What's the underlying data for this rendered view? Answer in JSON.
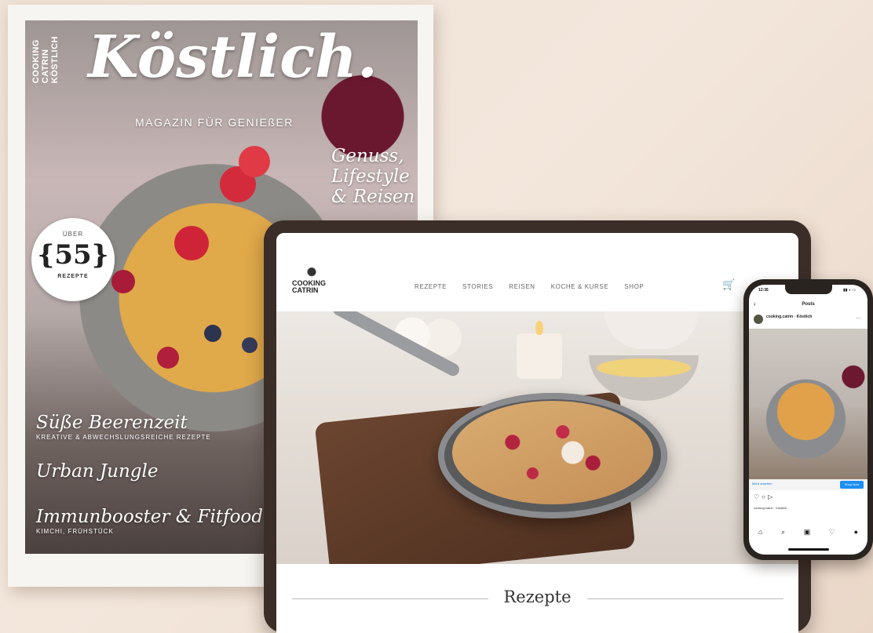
{
  "magazine": {
    "brand_lines": [
      "COOKING",
      "CATRIN",
      "KÖSTLICH"
    ],
    "title": "Köstlich.",
    "subtitle": "MAGAZIN FÜR GENIEßER",
    "headline": [
      "Genuss,",
      "Lifestyle",
      "& Reisen"
    ],
    "badge": {
      "top": "ÜBER",
      "number": "{55}",
      "label": "REZEPTE"
    },
    "cover_lines": [
      {
        "title": "Süße Beerenzeit",
        "sub": "KREATIVE & ABWECHSLUNGSREICHE REZEPTE"
      },
      {
        "title": "Urban Jungle",
        "sub": ""
      },
      {
        "title": "Immunbooster & Fitfood",
        "sub": "KIMCHI, FRÜHSTÜCK"
      }
    ]
  },
  "website": {
    "logo_text": [
      "COOKING",
      "CATRIN"
    ],
    "nav": [
      "REZEPTE",
      "STORIES",
      "REISEN",
      "KOCHE & KURSE",
      "SHOP"
    ],
    "cart_icon": "cart-icon",
    "section_title": "Rezepte"
  },
  "phone": {
    "time": "12:36",
    "status_icons": "▮▮ ◗ ▭",
    "screen_title": "Posts",
    "back_icon": "‹",
    "more_icon": "…",
    "cta_text": "Mehr ansehen",
    "cta_button": "Shop Now",
    "caption": "cooking.catrin · Köstlich",
    "tab_icons": [
      "⌂",
      "⌕",
      "▣",
      "♡",
      "●"
    ]
  },
  "colors": {
    "tablet_frame": "#3b2d28",
    "background": "#efe2d6",
    "ig_blue": "#1d8ff5"
  }
}
